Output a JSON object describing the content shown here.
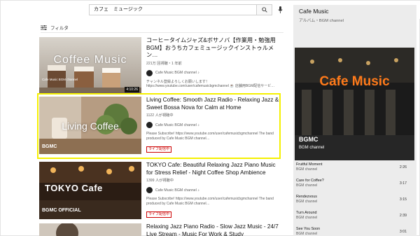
{
  "search": {
    "query": "カフェ　ミュージック"
  },
  "filter": {
    "label": "フィルタ"
  },
  "results": [
    {
      "title": "コーヒータイムジャズ&ボサノバ【作業用・勉強用BGM】おうちカフェミュージックインストゥルメン…",
      "meta": "221万 回視聴・1 年前",
      "channel": "Cafe Music BGM channel ♪",
      "description": "チャンネル登録よろしくお願いします！ https://www.youtube.com/user/cafemusicbgmchannel ☕ 店舗用BGM配信サービ…",
      "thumb_text": "Coffee Music",
      "thumb_brand": "Cafe Music BGM channel",
      "duration": "4:10:26"
    },
    {
      "title": "Living Coffee: Smooth Jazz Radio - Relaxing Jazz & Sweet Bossa Nova for Calm at Home",
      "meta": "1122 人が視聴中",
      "channel": "Cafe Music BGM channel ♪",
      "description": "Please Subscribe! https://www.youtube.com/user/cafemusicbgmchannel The band produced by Cafe Music BGM channel…",
      "live": "ライブ配信中",
      "thumb_text": "Living Coffee",
      "thumb_brand": "BGMC"
    },
    {
      "title": "TOKYO Cafe: Beautiful Relaxing Jazz Piano Music for Stress Relief - Night Coffee Shop Ambience",
      "meta": "1399 人が視聴中",
      "channel": "Cafe Music BGM channel ♪",
      "description": "Please Subscribe! https://www.youtube.com/user/cafemusicbgmchannel The band produced by Cafe Music BGM channel…",
      "live": "ライブ配信中",
      "thumb_text": "TOKYO Cafe",
      "thumb_brand": "BGMC OFFICIAL"
    },
    {
      "title": "Relaxing Jazz Piano Radio - Slow Jazz Music - 24/7 Live Stream - Music For Work & Study"
    }
  ],
  "panel": {
    "title": "Cafe Music",
    "subtitle": "アルバム・BGM channel",
    "art_text": "Cafe Music",
    "art_brand": "BGMC",
    "art_brand_sub": "BGM channel",
    "tracks": [
      {
        "title": "Fruitful Moment",
        "artist": "BGM channel",
        "duration": "2:26"
      },
      {
        "title": "Care for Coffee?",
        "artist": "BGM channel",
        "duration": "3:17"
      },
      {
        "title": "Rendezvous",
        "artist": "BGM channel",
        "duration": "3:15"
      },
      {
        "title": "Turn Around",
        "artist": "BGM channel",
        "duration": "2:39"
      },
      {
        "title": "See You Soon",
        "artist": "BGM channel",
        "duration": "3:01"
      }
    ]
  }
}
